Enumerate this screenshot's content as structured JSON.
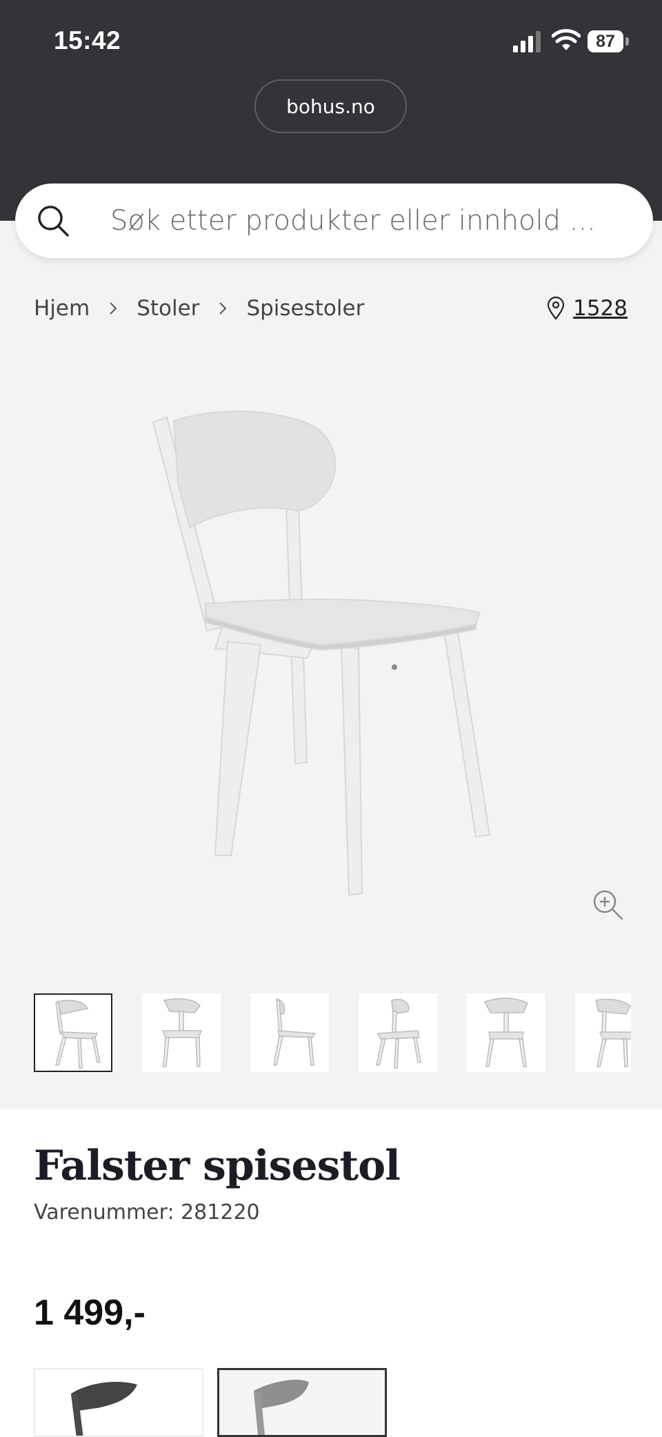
{
  "status_bar": {
    "time": "15:42",
    "battery": "87"
  },
  "browser": {
    "url": "bohus.no"
  },
  "search": {
    "placeholder": "Søk etter produkter eller innhold ..."
  },
  "breadcrumb": {
    "items": [
      "Hjem",
      "Stoler",
      "Spisestoler"
    ]
  },
  "store": {
    "number": "1528"
  },
  "product": {
    "title": "Falster spisestol",
    "sku": "Varenummer: 281220",
    "price": "1 499,-"
  },
  "gallery": {
    "thumbnail_count": 6,
    "active_index": 0
  },
  "variants": [
    {
      "color": "#3a3a3a",
      "selected": false
    },
    {
      "color": "#8f8f8f",
      "selected": true
    }
  ],
  "colors": {
    "status_bar": "#333338",
    "gallery_bg": "#f4f3f1",
    "title": "#1c1c26"
  },
  "icons": [
    "search-icon",
    "chevron-right-icon",
    "location-pin-icon",
    "zoom-in-icon",
    "signal-icon",
    "wifi-icon",
    "battery-icon"
  ]
}
